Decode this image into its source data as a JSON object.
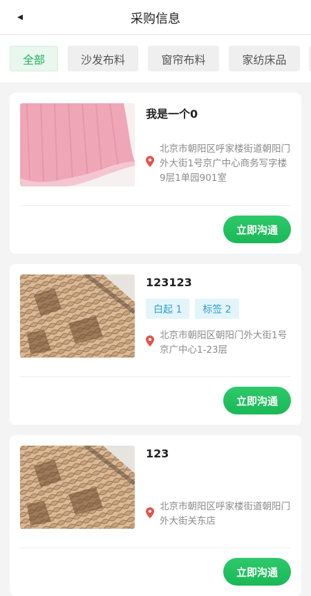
{
  "header": {
    "title": "采购信息"
  },
  "tabs": [
    {
      "label": "全部"
    },
    {
      "label": "沙发布料"
    },
    {
      "label": "窗帘布料"
    },
    {
      "label": "家纺床品"
    },
    {
      "label": ""
    }
  ],
  "items": [
    {
      "title": "我是一个0",
      "tags": [],
      "address": "北京市朝阳区呼家楼街道朝阳门外大街1号京广中心商务写字楼9层1单园901室",
      "action": "立即沟通",
      "image": "pink-fabric"
    },
    {
      "title": "123123",
      "tags": [
        "白起 1",
        "标签 2"
      ],
      "address": "北京市朝阳区朝阳门外大街1号京广中心1-23层",
      "action": "立即沟通",
      "image": "snakeskin-leather"
    },
    {
      "title": "123",
      "tags": [],
      "address": "北京市朝阳区呼家楼街道朝阳门外大街关东店",
      "action": "立即沟通",
      "image": "snakeskin-leather"
    }
  ],
  "colors": {
    "accent": "#1fb05a",
    "tag_text": "#2aa0cf",
    "tag_bg": "#e4f4fb"
  }
}
